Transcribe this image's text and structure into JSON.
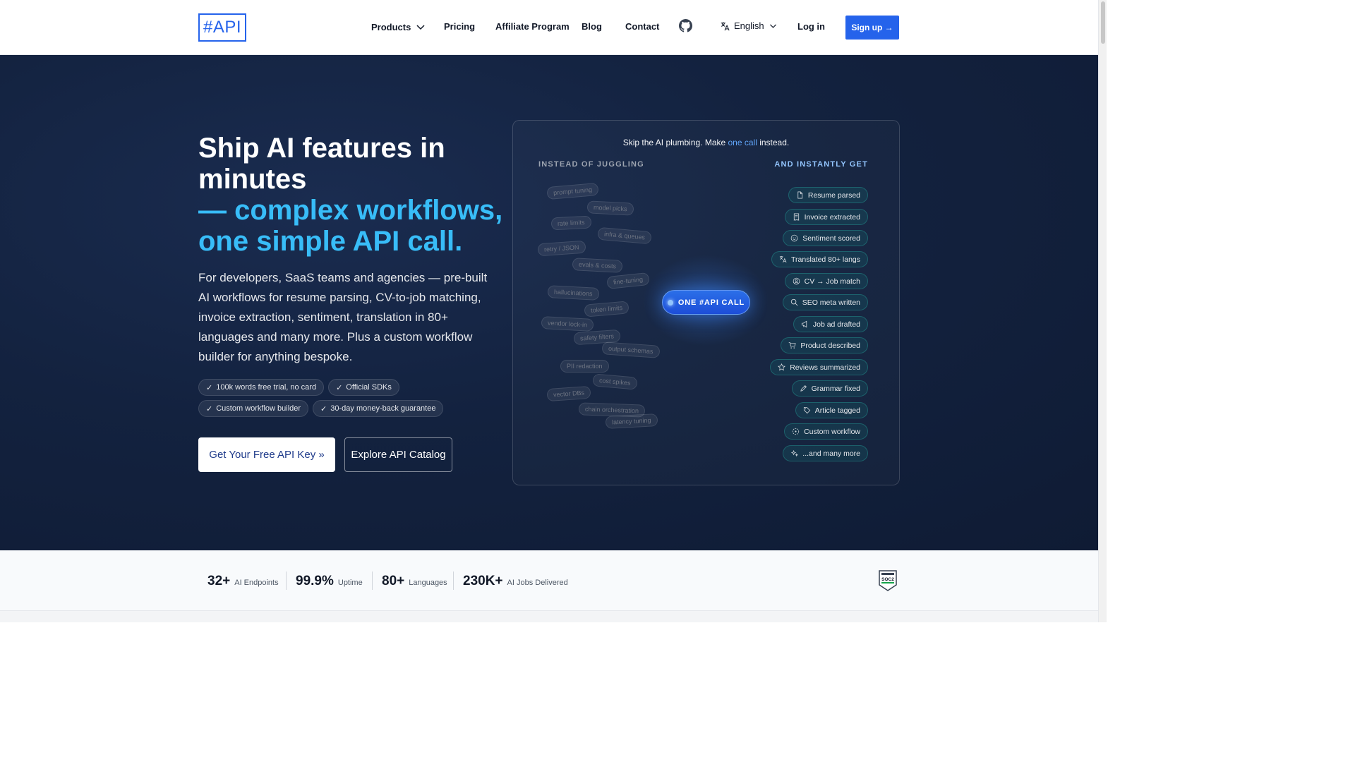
{
  "header": {
    "logo": "#API",
    "nav": [
      "Products",
      "Pricing",
      "Affiliate Program",
      "Blog",
      "Contact"
    ],
    "language": "English",
    "login": "Log in",
    "signup": "Sign up →"
  },
  "hero": {
    "title_line1": "Ship AI features in minutes",
    "title_line2": "— complex workflows, one simple API call.",
    "lead": "For developers, SaaS teams and agencies — pre-built AI workflows for resume parsing, CV-to-job matching, invoice extraction, sentiment, translation in 80+ languages and many more. Plus a custom workflow builder for anything bespoke.",
    "chips": [
      "100k words free trial, no card",
      "Official SDKs",
      "Custom workflow builder",
      "30-day money-back guarantee"
    ],
    "cta_primary": "Get Your Free API Key »",
    "cta_secondary": "Explore API Catalog"
  },
  "panel": {
    "title_pre": "Skip the AI plumbing. Make ",
    "title_highlight": "one call",
    "title_post": " instead.",
    "left_heading": "INSTEAD OF JUGGLING",
    "right_heading": "AND INSTANTLY GET",
    "juggling": [
      "prompt tuning",
      "model picks",
      "rate limits",
      "infra & queues",
      "retry / JSON",
      "evals & costs",
      "fine-tuning",
      "hallucinations",
      "token limits",
      "vendor lock-in",
      "safety filters",
      "output schemas",
      "PII redaction",
      "cost spikes",
      "vector DBs",
      "chain orchestration",
      "latency tuning"
    ],
    "center_button": "ONE #API CALL",
    "results": [
      {
        "label": "Resume parsed",
        "icon": "document-icon"
      },
      {
        "label": "Invoice extracted",
        "icon": "receipt-icon"
      },
      {
        "label": "Sentiment scored",
        "icon": "smile-icon"
      },
      {
        "label": "Translated 80+ langs",
        "icon": "translate-icon"
      },
      {
        "label": "CV → Job match",
        "icon": "user-circle-icon"
      },
      {
        "label": "SEO meta written",
        "icon": "search-icon"
      },
      {
        "label": "Job ad drafted",
        "icon": "megaphone-icon"
      },
      {
        "label": "Product described",
        "icon": "cart-icon"
      },
      {
        "label": "Reviews summarized",
        "icon": "star-icon"
      },
      {
        "label": "Grammar fixed",
        "icon": "pencil-icon"
      },
      {
        "label": "Article tagged",
        "icon": "tag-icon"
      },
      {
        "label": "Custom workflow",
        "icon": "workflow-icon"
      },
      {
        "label": "...and many more",
        "icon": "sparkles-icon"
      }
    ]
  },
  "stats": [
    {
      "value": "32+",
      "label": "AI Endpoints"
    },
    {
      "value": "99.9%",
      "label": "Uptime"
    },
    {
      "value": "80+",
      "label": "Languages"
    },
    {
      "value": "230K+",
      "label": "AI Jobs Delivered"
    }
  ],
  "badge": "SOC2",
  "colors": {
    "accent": "#2563eb",
    "hero_bg": "#13223f",
    "highlight": "#38bdf8",
    "result_border": "#2dd4bf"
  }
}
